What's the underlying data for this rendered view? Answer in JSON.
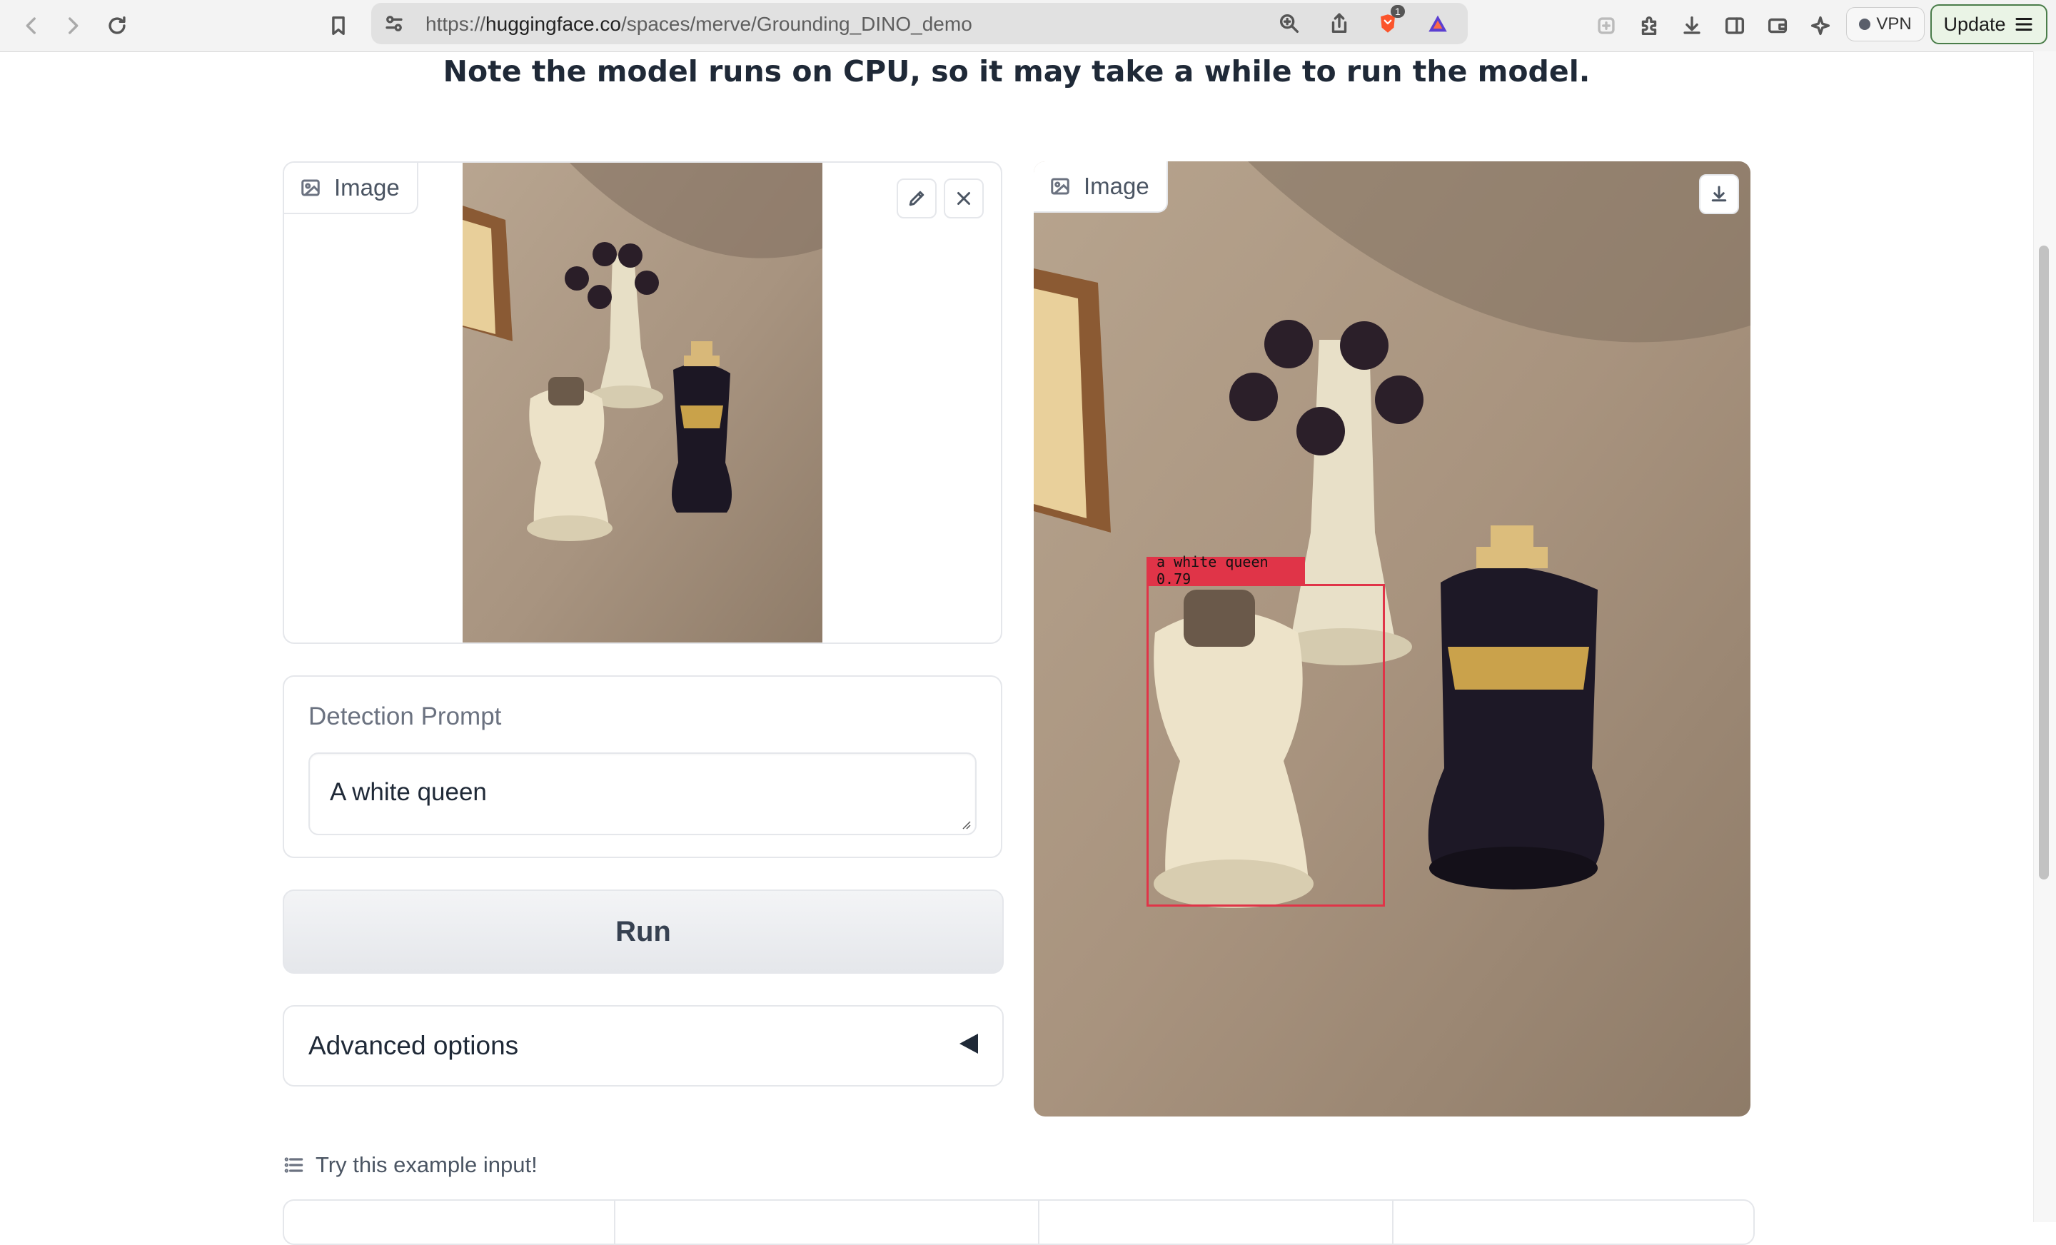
{
  "browser": {
    "url_prefix": "https://",
    "url_host": "huggingface.co",
    "url_path": "/spaces/merve/Grounding_DINO_demo",
    "shield_badge": "1",
    "vpn_label": "VPN",
    "update_label": "Update"
  },
  "page": {
    "note": "Note the model runs on CPU, so it may take a while to run the model."
  },
  "input_image": {
    "label": "Image"
  },
  "output_image": {
    "label": "Image",
    "detection_label": "a white queen 0.79",
    "detection_color": "#e03448"
  },
  "prompt": {
    "label": "Detection Prompt",
    "value": "A white queen"
  },
  "run_button": {
    "label": "Run"
  },
  "advanced": {
    "label": "Advanced options"
  },
  "examples": {
    "label": "Try this example input!"
  },
  "icons": {
    "back": "back-icon",
    "forward": "forward-icon",
    "reload": "reload-icon",
    "bookmark": "bookmark-icon",
    "site_settings": "site-settings-icon",
    "zoom": "zoom-icon",
    "share": "share-icon",
    "brave_shield": "brave-shield-icon",
    "brave_rewards": "brave-rewards-icon",
    "extensions": "extensions-icon",
    "downloads": "downloads-icon",
    "sidebar": "sidebar-icon",
    "wallet": "wallet-icon",
    "leo": "leo-ai-icon",
    "edit": "pencil-icon",
    "close": "close-icon",
    "download": "download-icon"
  }
}
